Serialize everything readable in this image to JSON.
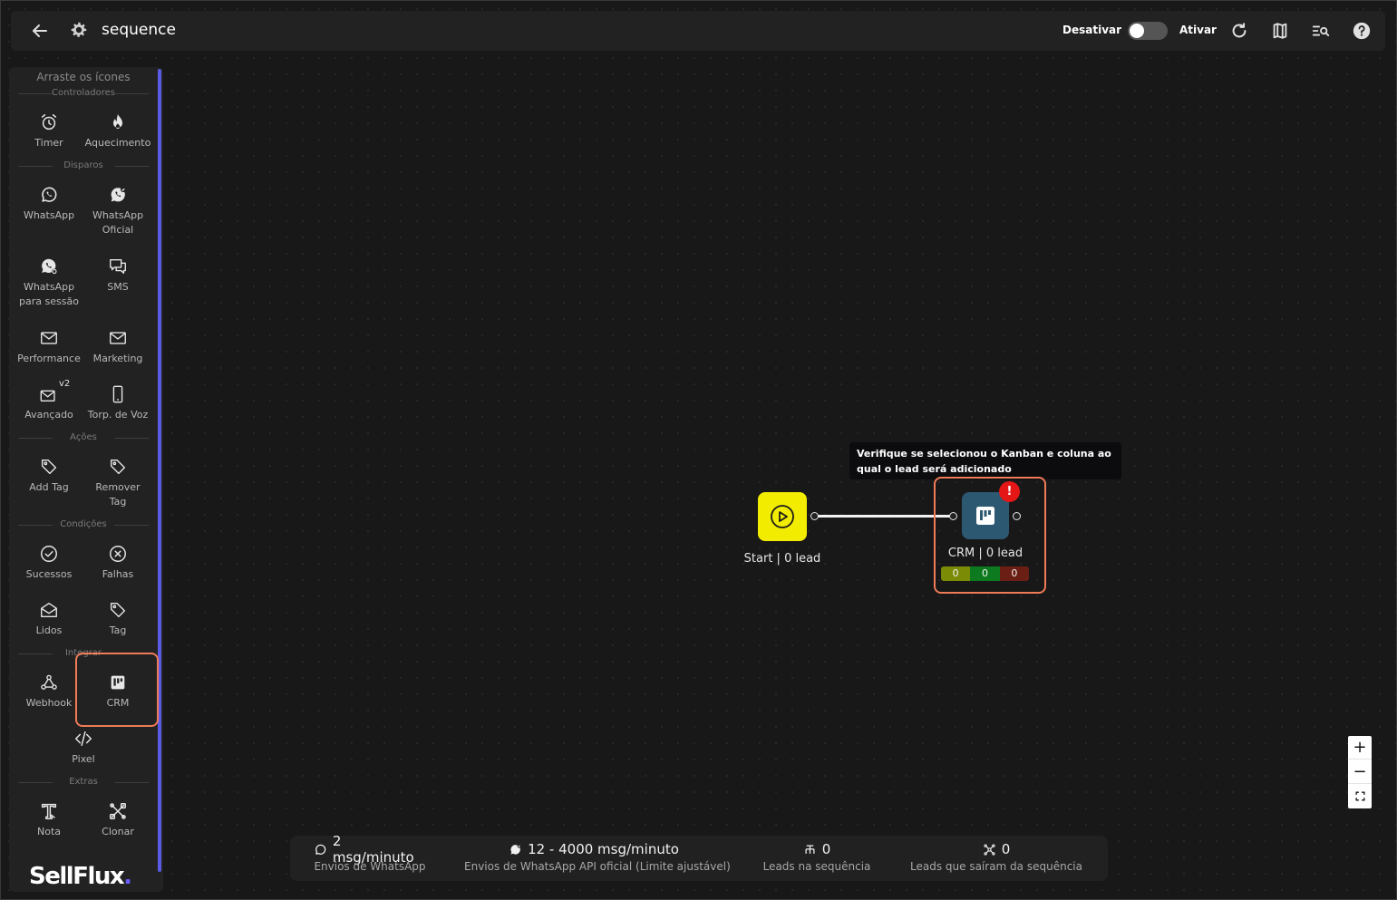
{
  "header": {
    "title": "sequence",
    "deactivate_label": "Desativar",
    "activate_label": "Ativar",
    "icons": [
      "back-arrow-icon",
      "gear-icon",
      "refresh-icon",
      "map-icon",
      "search-list-icon",
      "help-icon"
    ]
  },
  "sidebar": {
    "heading": "Arraste os ícones",
    "sections": {
      "controladores": "Controladores",
      "disparos": "Disparos",
      "acoes": "Ações",
      "condicoes": "Condições",
      "integrar": "Integrar",
      "extras": "Extras"
    },
    "tools": {
      "timer": "Timer",
      "aquecimento": "Aquecimento",
      "whatsapp": "WhatsApp",
      "whatsapp_oficial_1": "WhatsApp",
      "whatsapp_oficial_2": "Oficial",
      "whatsapp_sessao_1": "WhatsApp",
      "whatsapp_sessao_2": "para sessão",
      "sms": "SMS",
      "performance": "Performance",
      "marketing": "Marketing",
      "avancado": "Avançado",
      "avancado_badge": "v2",
      "torpedo": "Torp. de Voz",
      "add_tag": "Add Tag",
      "remover_tag_1": "Remover",
      "remover_tag_2": "Tag",
      "sucessos": "Sucessos",
      "falhas": "Falhas",
      "lidos": "Lidos",
      "tag": "Tag",
      "webhook": "Webhook",
      "crm": "CRM",
      "pixel": "Pixel",
      "nota": "Nota",
      "clonar": "Clonar"
    },
    "logo_text": "SellFlux",
    "logo_dot": "."
  },
  "canvas": {
    "tooltip_line1": "Verifique se selecionou o Kanban e coluna ao",
    "tooltip_line2": "qual o lead será adicionado",
    "start_node": {
      "label": "Start | 0 lead"
    },
    "crm_node": {
      "label": "CRM | 0 lead",
      "alert": "!",
      "counters": [
        "0",
        "0",
        "0"
      ],
      "counter_colors": [
        "#7c8b06",
        "#0e7a1f",
        "#6b1f14"
      ]
    },
    "zoom": {
      "in": "+",
      "out": "−"
    }
  },
  "stats": [
    {
      "value": "2 msg/minuto",
      "desc": "Envios de WhatsApp",
      "icon": "whatsapp-icon"
    },
    {
      "value": "12 - 4000 msg/minuto",
      "desc": "Envios de WhatsApp API oficial (Limite ajustável)",
      "icon": "whatsapp-official-icon"
    },
    {
      "value": "0",
      "desc": "Leads na sequência",
      "icon": "hierarchy-icon"
    },
    {
      "value": "0",
      "desc": "Leads que saíram da sequência",
      "icon": "exit-network-icon"
    }
  ],
  "colors": {
    "accent_highlight": "#ef7b57",
    "start_node": "#f2ec00",
    "crm_node": "#2d5872",
    "scrollbar": "#5b5be6",
    "alert": "#e51616"
  }
}
